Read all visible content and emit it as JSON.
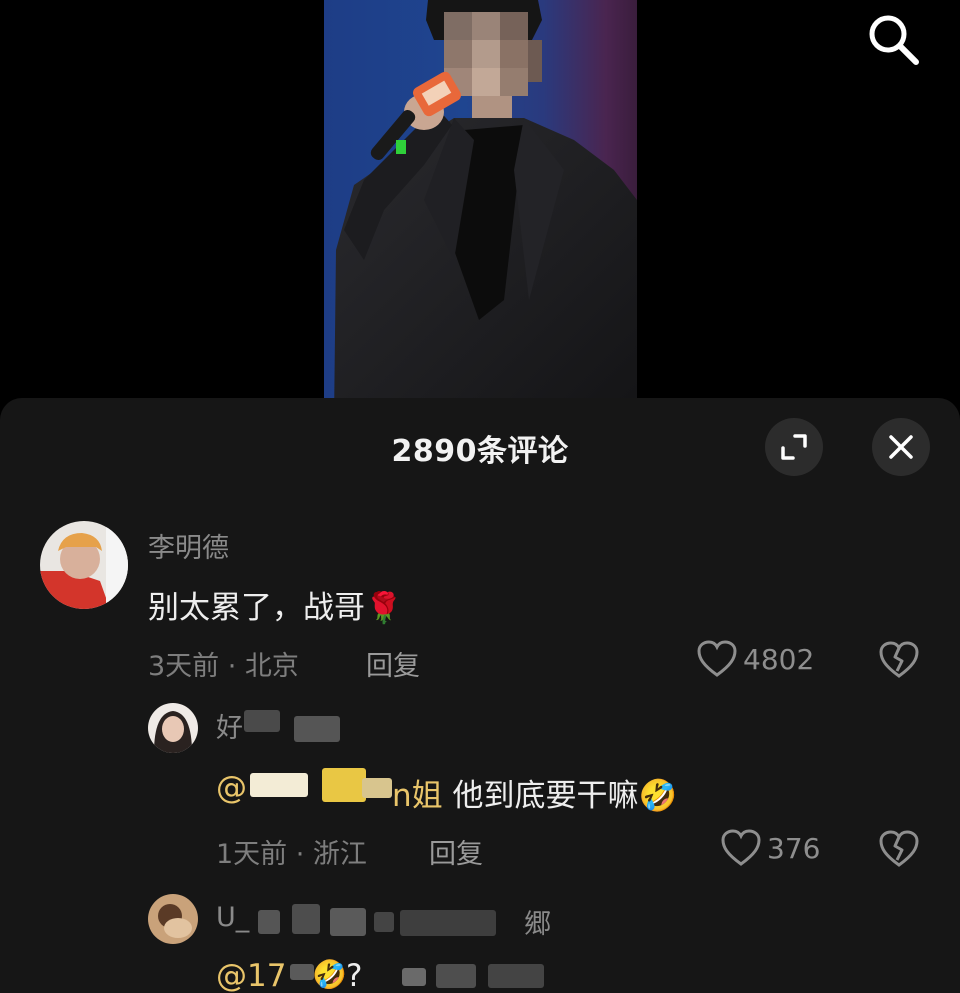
{
  "video": {
    "search_icon": "search-icon"
  },
  "comments_panel": {
    "title": "2890条评论",
    "expand_icon": "expand-icon",
    "close_icon": "close-icon"
  },
  "comments": [
    {
      "username": "李明德",
      "text": "别太累了，战哥",
      "emoji": "🌹",
      "time_location": "3天前 · 北京",
      "reply_label": "回复",
      "likes": "4802"
    },
    {
      "username_visible": "好",
      "mention_suffix": "n姐",
      "text": " 他到底要干嘛",
      "emoji": "🤣",
      "time_location": "1天前 · 浙江",
      "reply_label": "回复",
      "likes": "376"
    },
    {
      "username_prefix": "U_",
      "username_suffix": "郷",
      "mention_prefix": "@17",
      "text_tail": "?"
    }
  ],
  "colors": {
    "sheet_bg": "#161616",
    "mention": "#e9c56a",
    "meta": "#7e7e7e"
  }
}
